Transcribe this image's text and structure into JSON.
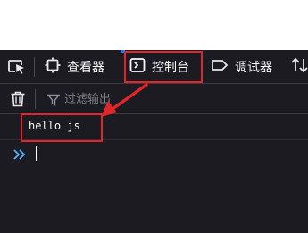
{
  "toolbar": {
    "tabs": [
      {
        "label": "查看器",
        "icon": "inspector-icon"
      },
      {
        "label": "控制台",
        "icon": "console-icon"
      },
      {
        "label": "调试器",
        "icon": "debugger-icon"
      },
      {
        "label": "",
        "icon": "network-icon"
      }
    ],
    "active_tab": "控制台",
    "picker_icon": "element-picker-icon"
  },
  "filter": {
    "clear_icon": "trash-icon",
    "filter_icon": "funnel-icon",
    "placeholder": "过滤输出",
    "value": ""
  },
  "console": {
    "messages": [
      {
        "text": "hello js"
      }
    ],
    "prompt_icon": "double-chevron-icon"
  },
  "annotations": {
    "highlight_color": "#e0262a"
  },
  "colors": {
    "panel_bg": "#1c1b22",
    "text": "#f9f9fa",
    "prompt": "#4fb3ff",
    "accent": "#0a84ff"
  }
}
